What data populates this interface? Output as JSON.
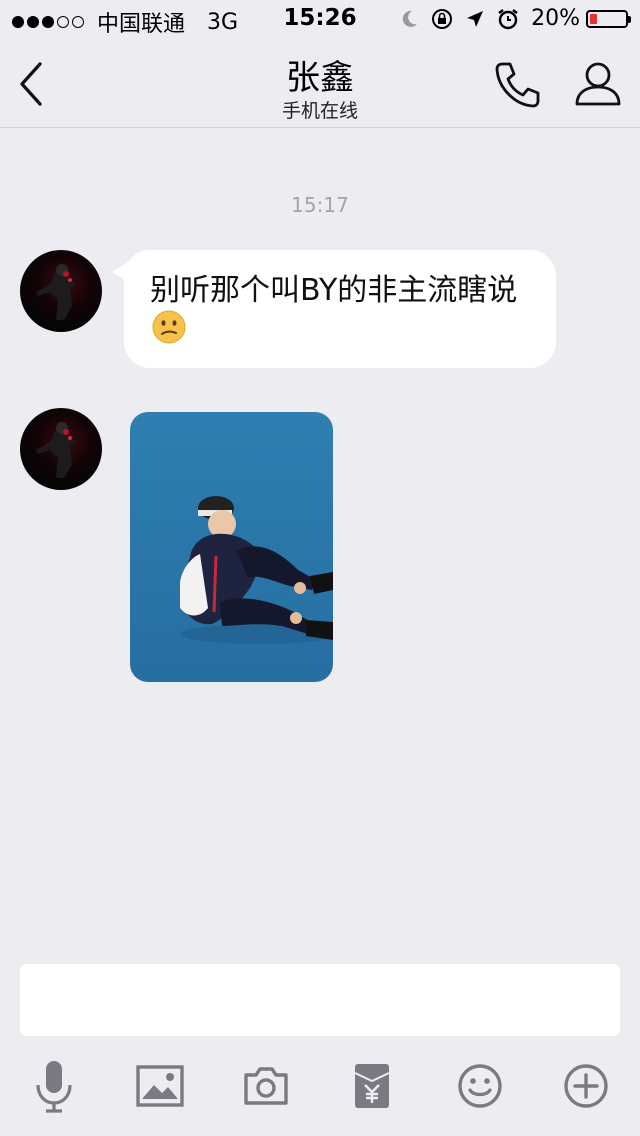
{
  "status_bar": {
    "signal_full": 3,
    "signal_empty": 2,
    "carrier": "中国联通",
    "network": "3G",
    "time": "15:26",
    "battery_percent": "20%",
    "battery_level": 0.2,
    "battery_color": "#E9302D",
    "icons": [
      "moon-icon",
      "rotation-lock-icon",
      "location-arrow-icon",
      "alarm-icon"
    ]
  },
  "header": {
    "title": "张鑫",
    "subtitle": "手机在线",
    "actions": [
      "back-icon",
      "phone-icon",
      "user-icon"
    ]
  },
  "chat": {
    "timestamp": "15:17",
    "messages": [
      {
        "type": "text",
        "text": "别听那个叫BY的非主流瞎说",
        "emoji": "confused-face"
      },
      {
        "type": "image",
        "description": "photo"
      }
    ]
  },
  "input": {
    "value": "",
    "placeholder": ""
  },
  "toolbar": {
    "items": [
      "microphone-icon",
      "image-icon",
      "camera-icon",
      "red-packet-icon",
      "emoji-icon",
      "plus-icon"
    ]
  },
  "colors": {
    "background": "#ECECF1",
    "bubble": "#FFFFFF",
    "icon_gray": "#7A7A82",
    "timestamp": "#A4A4AC"
  }
}
